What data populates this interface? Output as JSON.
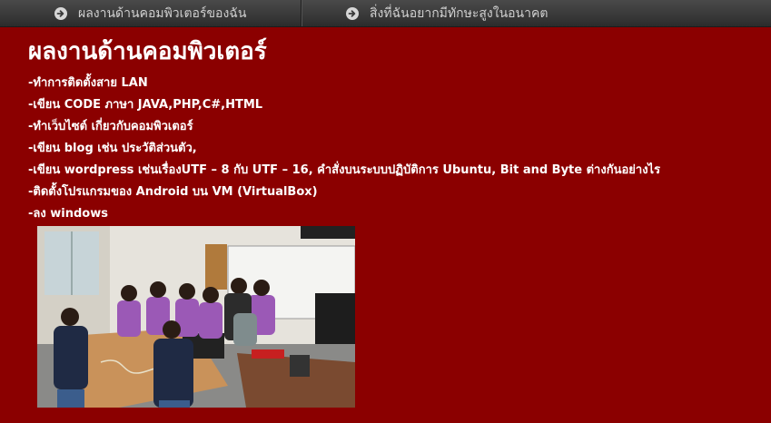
{
  "nav": {
    "items": [
      {
        "label": "ผลงานด้านคอมพิวเตอร์ของฉัน",
        "icon": "arrow-right-circle-icon"
      },
      {
        "label": "สิ่งที่ฉันอยากมีทักษะสูงในอนาคต",
        "icon": "arrow-right-circle-icon"
      }
    ]
  },
  "main": {
    "title": "ผลงานด้านคอมพิวเตอร์",
    "items": [
      "-ทำการติดตั้งสาย LAN",
      "-เขียน CODE ภาษา JAVA,PHP,C#,HTML",
      "-ทำเว็บไซต์ เกี่ยวกับคอมพิวเตอร์",
      "-เขียน blog เช่น ประวัติส่วนตัว,",
      "-เขียน wordpress เช่นเรื่องUTF – 8 กับ UTF – 16, คำสั่งบนระบบปฏิบัติการ Ubuntu, Bit and Byte ต่างกันอย่างไร",
      "-ติดตั้งโปรแกรมของ Android บน VM (VirtualBox)",
      "-ลง windows"
    ]
  },
  "colors": {
    "background": "#8b0000",
    "nav": "#3a3a3a",
    "text": "#ffffff"
  }
}
